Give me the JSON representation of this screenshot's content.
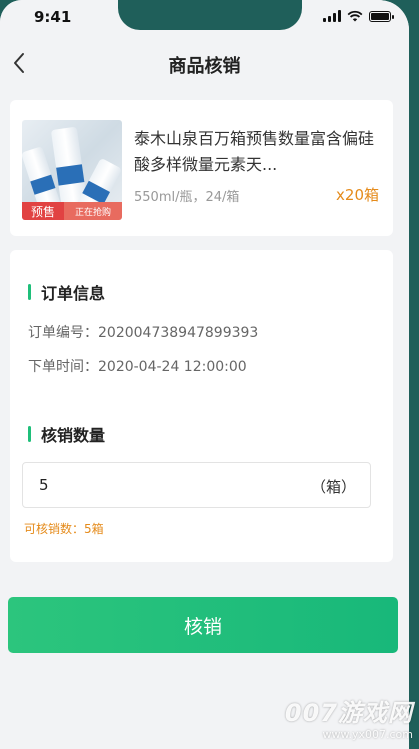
{
  "status": {
    "time": "9:41"
  },
  "header": {
    "title": "商品核销"
  },
  "product": {
    "name": "泰木山泉百万箱预售数量富含偏硅酸多样微量元素天...",
    "spec": "550ml/瓶，24/箱",
    "quantity": "x20箱",
    "tag_presale": "预售",
    "tag_selling": "正在抢购"
  },
  "order": {
    "section_title": "订单信息",
    "number_label": "订单编号：",
    "number_value": "202004738947899393",
    "time_label": "下单时间：",
    "time_value": "2020-04-24 12:00:00"
  },
  "redeem": {
    "section_title": "核销数量",
    "quantity_value": "5",
    "unit": "（箱）",
    "available": "可核销数：5箱"
  },
  "submit": {
    "label": "核销"
  },
  "watermark": {
    "logo": "007游戏网",
    "url": "www.yx007.com"
  },
  "colors": {
    "accent": "#1fbf7a",
    "warning": "#e58b1b",
    "presale": "#e14242"
  }
}
